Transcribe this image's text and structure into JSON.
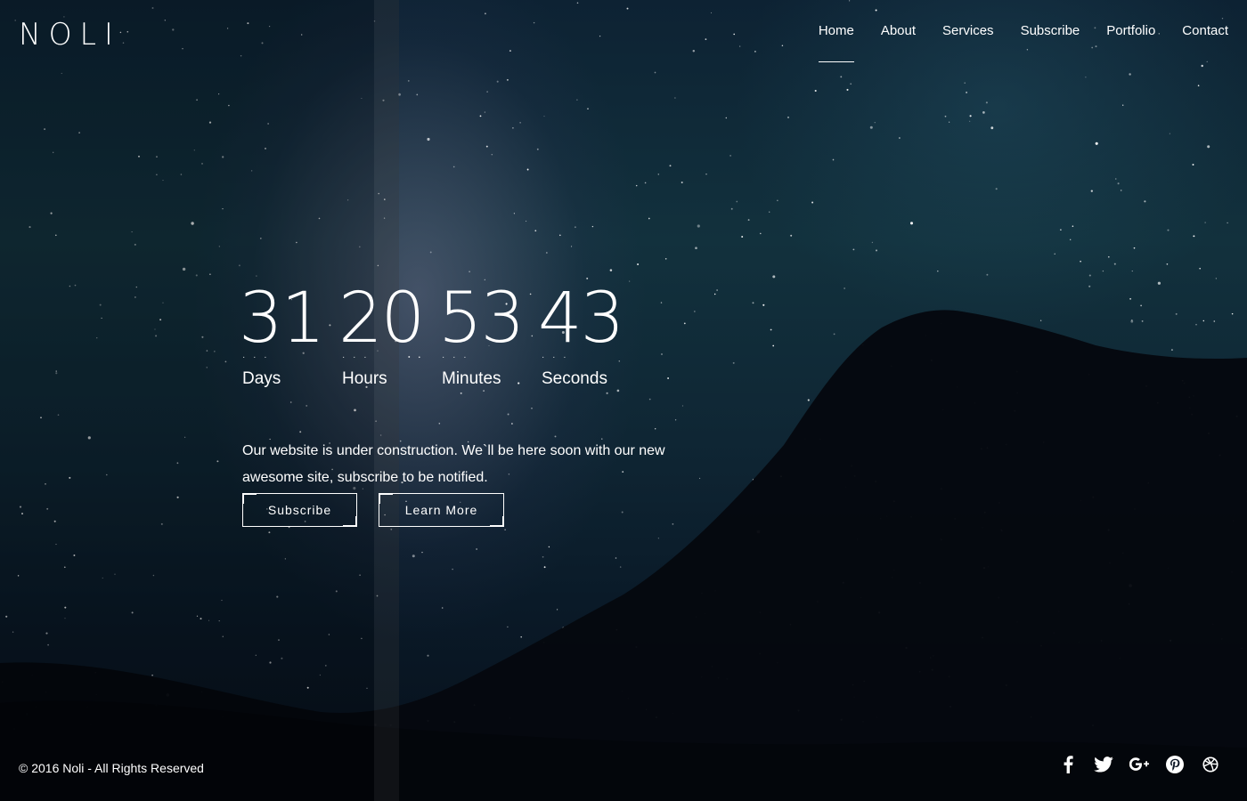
{
  "brand": {
    "logo": "NOLI"
  },
  "nav": {
    "items": [
      {
        "label": "Home",
        "active": true
      },
      {
        "label": "About"
      },
      {
        "label": "Services"
      },
      {
        "label": "Subscribe"
      },
      {
        "label": "Portfolio"
      },
      {
        "label": "Contact"
      }
    ]
  },
  "countdown": [
    {
      "value": "31",
      "label": "Days"
    },
    {
      "value": "20",
      "label": "Hours"
    },
    {
      "value": "53",
      "label": "Minutes"
    },
    {
      "value": "43",
      "label": "Seconds"
    }
  ],
  "countdown_dots": "· · ·",
  "message": "Our website is under construction. We`ll be here soon with our new awesome site, subscribe to be notified.",
  "buttons": {
    "subscribe": "Subscribe",
    "learn_more": "Learn More"
  },
  "footer": {
    "copyright": "© 2016 Noli - All Rights Reserved",
    "social_icons": [
      "facebook-icon",
      "twitter-icon",
      "google-plus-icon",
      "pinterest-icon",
      "dribbble-icon"
    ]
  },
  "colors": {
    "text": "#ffffff",
    "sky_top": "#0d2233",
    "sky_bottom": "#070f1a",
    "mountain": "#05080f"
  }
}
